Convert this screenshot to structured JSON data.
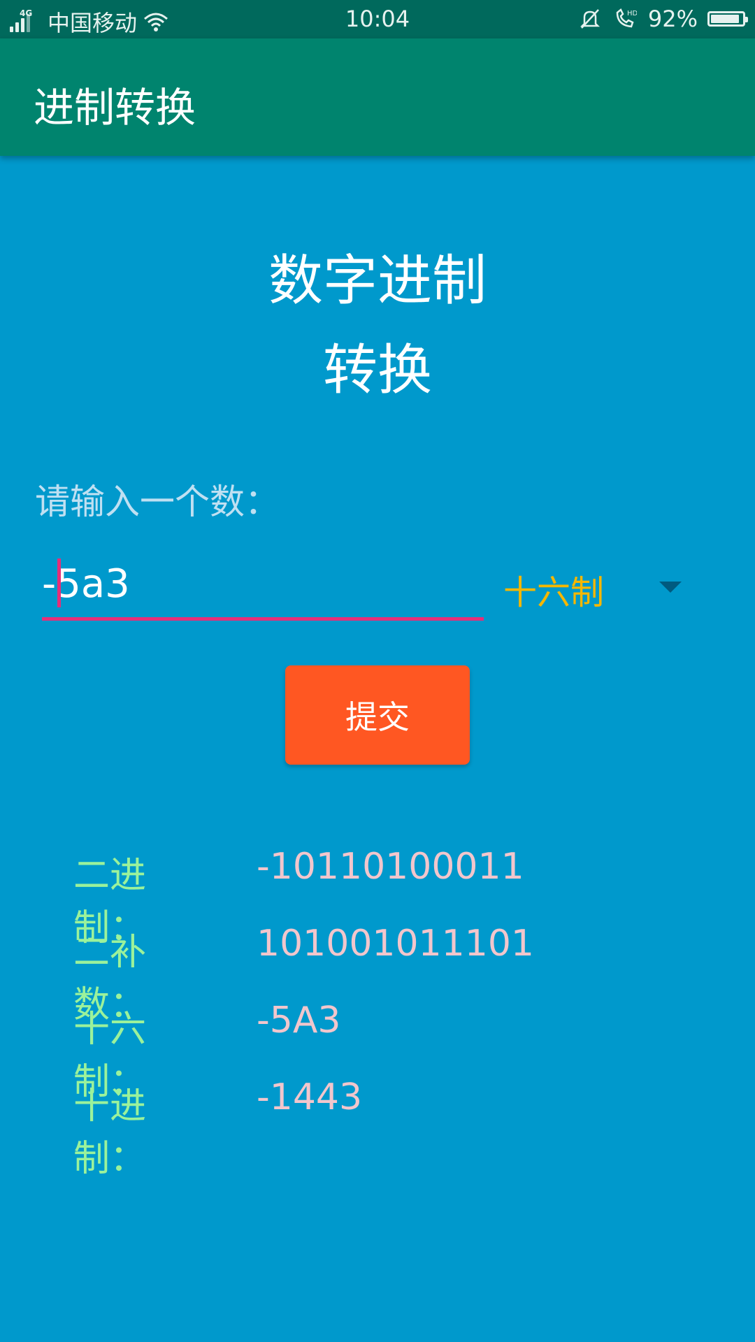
{
  "status_bar": {
    "network": "4G",
    "carrier": "中国移动",
    "time": "10:04",
    "battery_percent": "92%",
    "battery_level": 0.92
  },
  "app_bar": {
    "title": "进制转换"
  },
  "heading": {
    "line1": "数字进制",
    "line2": "转换"
  },
  "form": {
    "prompt_label": "请输入一个数：",
    "number_input_value": "-5a3",
    "base_select_value": "十六制",
    "submit_label": "提交"
  },
  "results": [
    {
      "label": "二进制：",
      "value": "-10110100011"
    },
    {
      "label": "二补数：",
      "value": "101001011101"
    },
    {
      "label": "十六制：",
      "value": "-5A3"
    },
    {
      "label": "十进制：",
      "value": "-1443"
    }
  ],
  "colors": {
    "status_bar": "#00695C",
    "app_bar": "#00846E",
    "background": "#0099CC",
    "button": "#FF5722",
    "accent_underline": "#E62E78",
    "select_text": "#F5B700",
    "result_label": "#9BF29B",
    "result_value": "#F2C6CC"
  }
}
